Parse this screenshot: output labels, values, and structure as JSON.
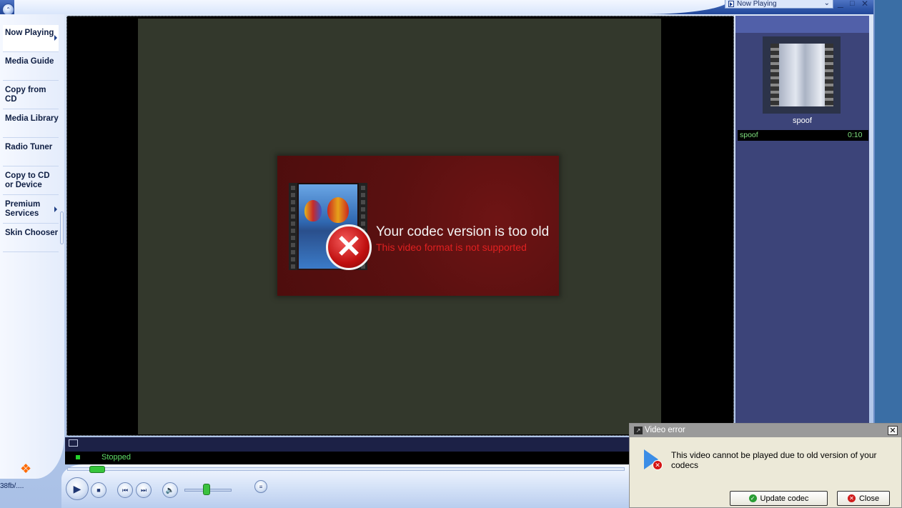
{
  "titlebar": {
    "now_playing_select": "Now Playing",
    "controls": [
      "minimize",
      "maximize",
      "close"
    ]
  },
  "sidebar": {
    "items": [
      {
        "label": "Now Playing",
        "has_arrow": true,
        "active": true
      },
      {
        "label": "Media Guide",
        "has_arrow": false
      },
      {
        "label": "Copy from CD",
        "has_arrow": false
      },
      {
        "label": "Media Library",
        "has_arrow": false
      },
      {
        "label": "Radio Tuner",
        "has_arrow": false
      },
      {
        "label": "Copy to CD or Device",
        "has_arrow": false
      },
      {
        "label": "Premium Services",
        "has_arrow": true
      },
      {
        "label": "Skin Chooser",
        "has_arrow": false
      }
    ],
    "bottom_label": "38fb/...."
  },
  "video": {
    "banner_title": "Your codec version is too old",
    "banner_subtitle": "This video format is not supported",
    "banner_icon": "error-x-icon",
    "banner_color": "#5a1010",
    "canvas_color": "#33382c"
  },
  "status": {
    "text": "Stopped",
    "color": "#5fdf6a"
  },
  "transport": {
    "buttons": [
      "play",
      "stop",
      "previous",
      "next",
      "mute",
      "equalizer"
    ],
    "volume_level": 0.45,
    "seek_position": 0.0
  },
  "playlist": {
    "album_title": "spoof",
    "tracks": [
      {
        "name": "spoof",
        "duration": "0:10"
      }
    ]
  },
  "dialog": {
    "title": "Video error",
    "message": "This video cannot be played due to old version of your codecs",
    "buttons": {
      "update": "Update codec",
      "close": "Close"
    }
  },
  "colors": {
    "accent_blue": "#2f56a8",
    "status_green": "#36c53b",
    "error_red": "#d01c1c"
  }
}
